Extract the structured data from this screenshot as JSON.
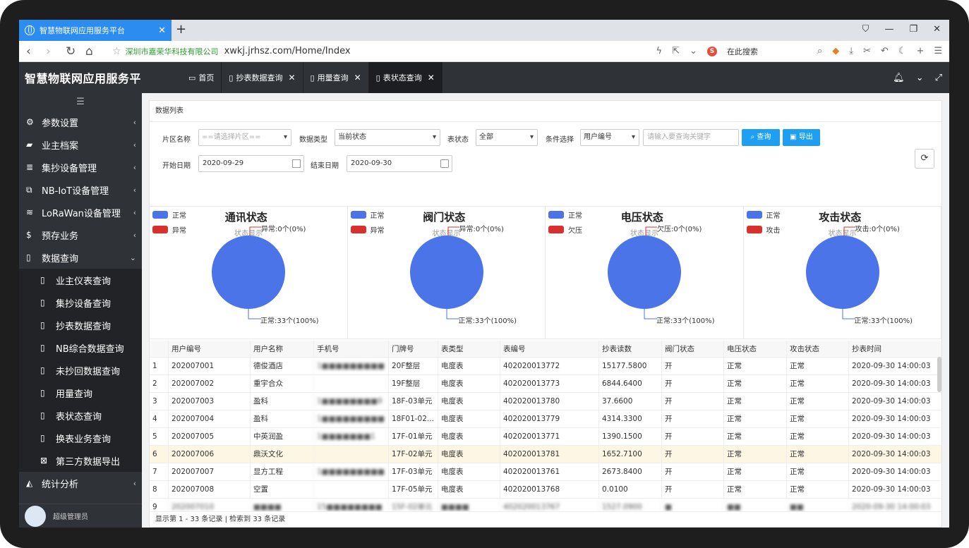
{
  "browser": {
    "tab_title": "智慧物联网应用服务平台",
    "site_name": "深圳市嘉荣华科技有限公司",
    "url": "xwkj.jrhsz.com/Home/Index",
    "search_placeholder": "在此搜索"
  },
  "header": {
    "brand": "智慧物联网应用服务平",
    "tabs": [
      {
        "label": "首页"
      },
      {
        "label": "抄表数据查询"
      },
      {
        "label": "用量查询"
      },
      {
        "label": "表状态查询"
      }
    ]
  },
  "sidebar": {
    "items": [
      {
        "label": "参数设置"
      },
      {
        "label": "业主档案"
      },
      {
        "label": "集抄设备管理"
      },
      {
        "label": "NB-IoT设备管理"
      },
      {
        "label": "LoRaWan设备管理"
      },
      {
        "label": "预存业务"
      },
      {
        "label": "数据查询"
      }
    ],
    "sub_items": [
      {
        "label": "业主仪表查询"
      },
      {
        "label": "集抄设备查询"
      },
      {
        "label": "抄表数据查询"
      },
      {
        "label": "NB综合数据查询"
      },
      {
        "label": "未抄回数据查询"
      },
      {
        "label": "用量查询"
      },
      {
        "label": "表状态查询"
      },
      {
        "label": "换表业务查询"
      },
      {
        "label": "第三方数据导出"
      }
    ],
    "after": {
      "label": "统计分析"
    },
    "user": "超级管理员"
  },
  "panel": {
    "title": "数据列表"
  },
  "filters": {
    "area_label": "片区名称",
    "area_placeholder": "==请选择片区==",
    "type_label": "数据类型",
    "type_value": "当前状态",
    "state_label": "表状态",
    "state_value": "全部",
    "cond_label": "条件选择",
    "cond_value": "用户编号",
    "keyword_placeholder": "请输入要查询关键字",
    "query_btn": "查询",
    "export_btn": "导出",
    "start_label": "开始日期",
    "start_value": "2020-09-29",
    "end_label": "结束日期",
    "end_value": "2020-09-30"
  },
  "colors": {
    "blue": "#4a74e8",
    "red": "#d9302c",
    "accent": "#1e9ff2"
  },
  "charts": [
    {
      "title": "通讯状态",
      "subtitle": "状态显示",
      "legend": [
        "正常",
        "异常"
      ],
      "top_label": "异常:0个(0%)",
      "bottom_label": "正常:33个(100%)"
    },
    {
      "title": "阀门状态",
      "subtitle": "状态显示",
      "legend": [
        "正常",
        "异常"
      ],
      "top_label": "异常:0个(0%)",
      "bottom_label": "正常:33个(100%)"
    },
    {
      "title": "电压状态",
      "subtitle": "状态显示",
      "legend": [
        "正常",
        "欠压"
      ],
      "top_label": "欠压:0个(0%)",
      "bottom_label": "正常:33个(100%)"
    },
    {
      "title": "攻击状态",
      "subtitle": "状态显示",
      "legend": [
        "正常",
        "攻击"
      ],
      "top_label": "攻击:0个(0%)",
      "bottom_label": "正常:33个(100%)"
    }
  ],
  "table": {
    "headers": [
      "",
      "用户编号",
      "用户名称",
      "手机号",
      "门牌号",
      "表类型",
      "表编号",
      "抄表读数",
      "阀门状态",
      "电压状态",
      "攻击状态",
      "抄表时间"
    ],
    "rows": [
      [
        "1",
        "202007001",
        "德俊酒店",
        "1■■■■■■■■■",
        "20F整层",
        "电度表",
        "402020013772",
        "15177.5800",
        "开",
        "正常",
        "正常",
        "2020-09-30 14:00:03"
      ],
      [
        "2",
        "202007002",
        "重宇合众",
        "",
        "19F整层",
        "电度表",
        "402020013773",
        "6844.6400",
        "开",
        "正常",
        "正常",
        "2020-09-30 14:00:03"
      ],
      [
        "3",
        "202007003",
        "盈科",
        "1■■■■■■■■9",
        "18F-03单元",
        "电度表",
        "402020013780",
        "37.6600",
        "开",
        "正常",
        "正常",
        "2020-09-30 14:00:03"
      ],
      [
        "4",
        "202007004",
        "盈科",
        "1■■■■■■■■■",
        "18F01-02...",
        "电度表",
        "402020013779",
        "4314.3300",
        "开",
        "正常",
        "正常",
        "2020-09-30 14:00:03"
      ],
      [
        "5",
        "202007005",
        "中英润盈",
        "1■■■■■■■1",
        "17F-01单元",
        "电度表",
        "402020013771",
        "1390.1500",
        "开",
        "正常",
        "正常",
        "2020-09-30 14:00:03"
      ],
      [
        "6",
        "202007006",
        "鼎沃文化",
        "",
        "17F-02单元",
        "电度表",
        "402020013781",
        "1652.7100",
        "开",
        "正常",
        "正常",
        "2020-09-30 14:00:03"
      ],
      [
        "7",
        "202007007",
        "显方工程",
        "1■■■■■■■■■",
        "17F-03单元",
        "电度表",
        "402020013761",
        "2673.8400",
        "开",
        "正常",
        "正常",
        "2020-09-30 14:00:03"
      ],
      [
        "8",
        "202007008",
        "空置",
        "",
        "17F-05单元",
        "电度表",
        "402020013768",
        "0.0100",
        "开",
        "正常",
        "正常",
        "2020-09-30 14:00:03"
      ]
    ],
    "partial_row": [
      "9",
      "202007010",
      "■■■■",
      "15■■■■■■■■",
      "15F-02单元",
      "■■■■",
      "402020013767",
      "1527.0900",
      "■",
      "■■",
      "■■",
      "2020-09-30 14:00:03"
    ]
  },
  "footer": {
    "text": "显示第 1 - 33 条记录 | 检索到 33 条记录"
  }
}
